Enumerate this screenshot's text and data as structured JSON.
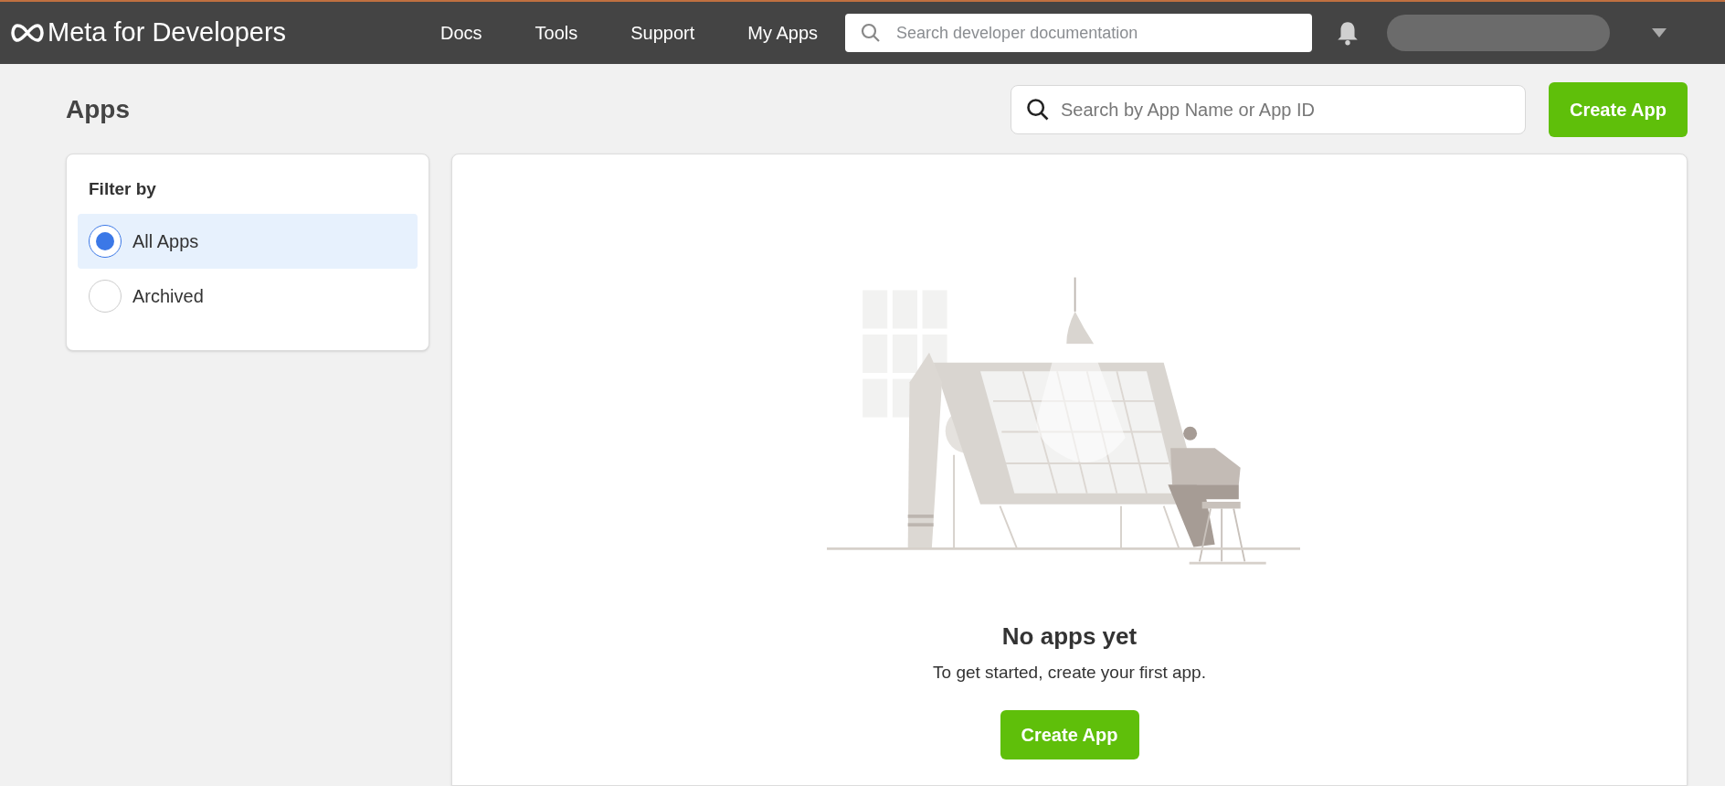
{
  "header": {
    "logo": "Meta for Developers",
    "nav": [
      {
        "label": "Docs"
      },
      {
        "label": "Tools"
      },
      {
        "label": "Support"
      },
      {
        "label": "My Apps"
      }
    ],
    "search": {
      "placeholder": "Search developer documentation"
    }
  },
  "page": {
    "title": "Apps",
    "search": {
      "placeholder": "Search by App Name or App ID"
    },
    "create_button": "Create App"
  },
  "filter": {
    "title": "Filter by",
    "options": [
      {
        "label": "All Apps",
        "selected": true
      },
      {
        "label": "Archived",
        "selected": false
      }
    ]
  },
  "empty_state": {
    "title": "No apps yet",
    "message": "To get started, create your first app.",
    "button": "Create App"
  }
}
